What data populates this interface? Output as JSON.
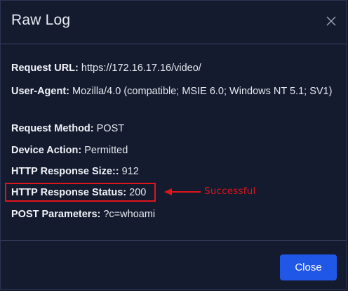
{
  "modal": {
    "title": "Raw Log",
    "close_icon": "close-icon",
    "close_button_label": "Close"
  },
  "fields": [
    {
      "key": "Request URL:",
      "value": " https://172.16.17.16/video/"
    },
    {
      "key": "User-Agent:",
      "value": " Mozilla/4.0 (compatible; MSIE 6.0; Windows NT 5.1; SV1)"
    },
    {
      "key": "Request Method:",
      "value": " POST"
    },
    {
      "key": "Device Action:",
      "value": " Permitted"
    },
    {
      "key": "HTTP Response Size::",
      "value": " 912"
    },
    {
      "key": "HTTP Response Status:",
      "value": " 200"
    },
    {
      "key": "POST Parameters:",
      "value": " ?c=whoami"
    }
  ],
  "annotation": {
    "text": "Successful",
    "color": "#e0141b"
  },
  "colors": {
    "background": "#141b2e",
    "primary_button": "#2157e6",
    "divider": "#3a4566"
  }
}
